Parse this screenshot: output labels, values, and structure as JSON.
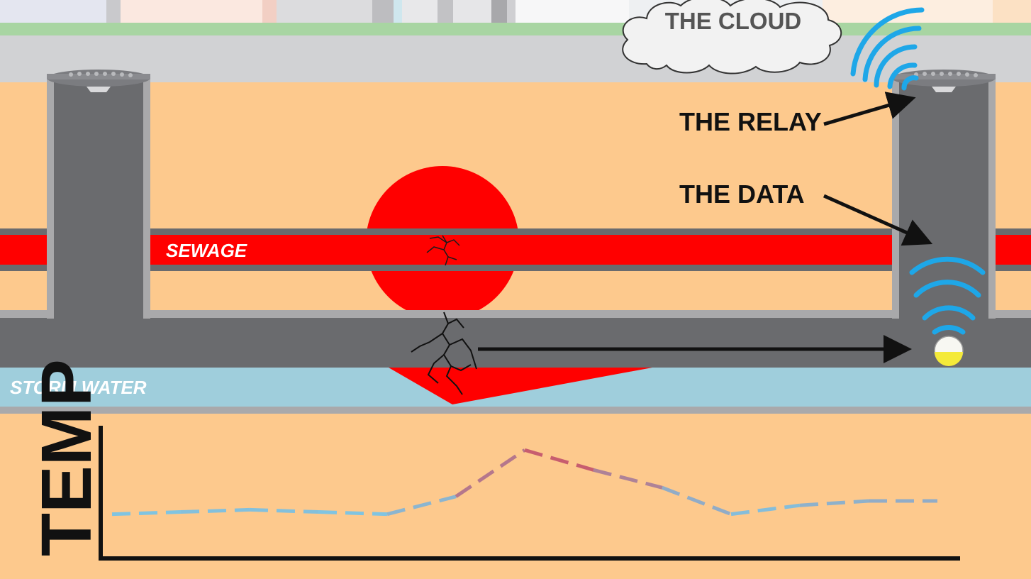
{
  "labels": {
    "cloud": "THE CLOUD",
    "relay": "THE RELAY",
    "data": "THE DATA",
    "sewage": "SEWAGE",
    "storm_water": "STORM WATER",
    "temp_axis": "TEMP"
  },
  "colors": {
    "soil": "#fdc98d",
    "pavement": "#d1d2d4",
    "grass": "#a8d5a2",
    "pipe_gray": "#6a6b6e",
    "pipe_rim": "#a9a9ab",
    "sewage_red": "#ff0000",
    "storm_blue": "#9fcedc",
    "wifi_blue": "#1ea7e8",
    "line_cool": "#7fc6e3",
    "line_warm": "#d44a5a"
  },
  "icons": [
    "cloud-icon",
    "wifi-signal-icon",
    "crack-icon",
    "sensor-icon",
    "manhole-lid-icon"
  ],
  "chart_data": {
    "type": "line",
    "title": "",
    "ylabel": "TEMP",
    "xlabel": "",
    "x": [
      0,
      1,
      2,
      3,
      4,
      5,
      6,
      7,
      8,
      9,
      10,
      11,
      12
    ],
    "series": [
      {
        "values": [
          20,
          21,
          22,
          21,
          20,
          28,
          49,
          40,
          32,
          20,
          24,
          26,
          26
        ]
      }
    ],
    "ylim": [
      0,
      60
    ],
    "grid": false,
    "legend": "none"
  }
}
